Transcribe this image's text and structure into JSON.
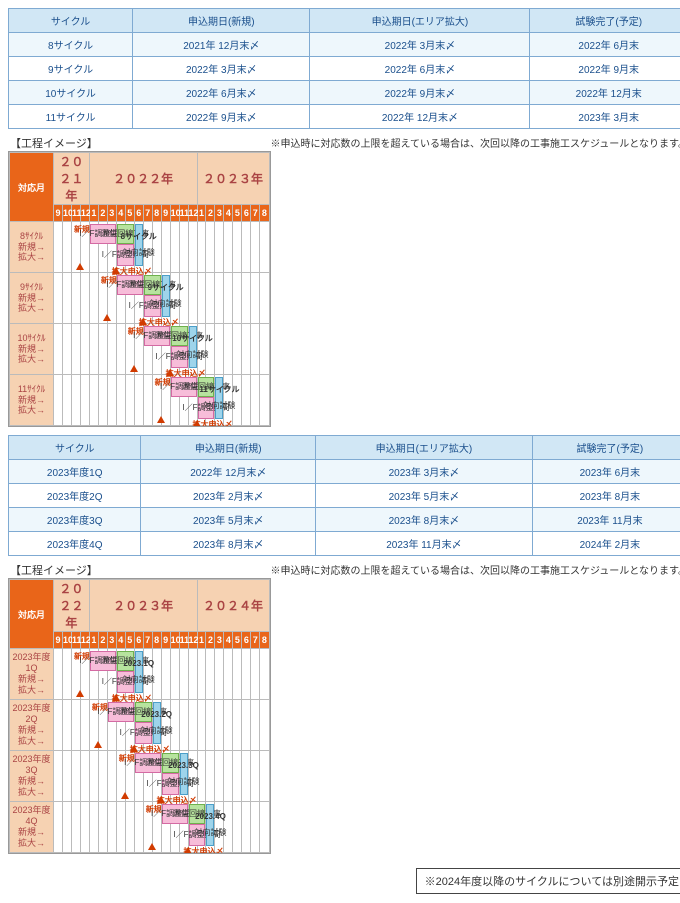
{
  "tables": {
    "headers": [
      "サイクル",
      "申込期日(新規)",
      "申込期日(エリア拡大)",
      "試験完了(予定)"
    ],
    "rows1": [
      [
        "8サイクル",
        "2021年 12月末〆",
        "2022年 3月末〆",
        "2022年 6月末"
      ],
      [
        "9サイクル",
        "2022年 3月末〆",
        "2022年 6月末〆",
        "2022年 9月末"
      ],
      [
        "10サイクル",
        "2022年 6月末〆",
        "2022年 9月末〆",
        "2022年 12月末"
      ],
      [
        "11サイクル",
        "2022年 9月末〆",
        "2022年 12月末〆",
        "2023年 3月末"
      ]
    ],
    "rows2": [
      [
        "2023年度1Q",
        "2022年 12月末〆",
        "2023年 3月末〆",
        "2023年 6月末"
      ],
      [
        "2023年度2Q",
        "2023年 2月末〆",
        "2023年 5月末〆",
        "2023年 8月末"
      ],
      [
        "2023年度3Q",
        "2023年 5月末〆",
        "2023年 8月末〆",
        "2023年 11月末"
      ],
      [
        "2023年度4Q",
        "2023年 8月末〆",
        "2023年 11月末〆",
        "2024年 2月末"
      ]
    ]
  },
  "titles": {
    "section": "【工程イメージ】",
    "note": "※申込時に対応数の上限を超えている場合は、次回以降の工事施工スケジュールとなります。",
    "footer": "※2024年度以降のサイクルについては別途開示予定"
  },
  "gantt": {
    "rowlabel_corner": "対応月",
    "years1": [
      "２０２１年",
      "２０２２年",
      "２０２３年"
    ],
    "months1": [
      "9",
      "10",
      "11",
      "12",
      "1",
      "2",
      "3",
      "4",
      "5",
      "6",
      "7",
      "8",
      "9",
      "10",
      "11",
      "12",
      "1",
      "2",
      "3",
      "4",
      "5",
      "6",
      "7",
      "8"
    ],
    "years2": [
      "２０２２年",
      "２０２３年",
      "２０２４年"
    ],
    "months2": [
      "9",
      "10",
      "11",
      "12",
      "1",
      "2",
      "3",
      "4",
      "5",
      "6",
      "7",
      "8",
      "9",
      "10",
      "11",
      "12",
      "1",
      "2",
      "3",
      "4",
      "5",
      "6",
      "7",
      "8"
    ],
    "rowlabels1": [
      "8ｻｲｸﾙ",
      "新規→",
      "拡大→",
      "9ｻｲｸﾙ",
      "新規→",
      "拡大→",
      "10ｻｲｸﾙ",
      "新規→",
      "拡大→",
      "11ｻｲｸﾙ",
      "新規→",
      "拡大→"
    ],
    "rowlabels2": [
      "2023年度1Q",
      "新規→",
      "拡大→",
      "2023年度2Q",
      "新規→",
      "拡大→",
      "2023年度3Q",
      "新規→",
      "拡大→",
      "2023年度4Q",
      "新規→",
      "拡大→"
    ],
    "text": {
      "shinki": "新規申込〆",
      "kakudai": "拡大申込〆",
      "if_period": "I／F調整期間",
      "line_work": "通信回線工事",
      "test_prefix_cycle": [
        "8サイクル",
        "9サイクル",
        "10サイクル",
        "11サイクル"
      ],
      "test_prefix_q": [
        "2023.1Q",
        "2023.2Q",
        "2023.3Q",
        "2023.4Q"
      ],
      "test": "対向試験"
    }
  },
  "chart_data": {
    "type": "gantt",
    "title": "工程イメージ",
    "sets": [
      {
        "timeline": {
          "start": "2021-09",
          "end": "2023-08"
        },
        "rows": [
          {
            "cycle": "8サイクル",
            "新規申込〆": "2021-12",
            "拡大申込〆": "2022-03",
            "I/F調整期間": {
              "新規": [
                "2022-01",
                "2022-03"
              ],
              "拡大": [
                "2022-04",
                "2022-05"
              ]
            },
            "通信回線工事": [
              "2022-04",
              "2022-05"
            ],
            "対向試験": [
              "2022-06",
              "2022-06"
            ]
          },
          {
            "cycle": "9サイクル",
            "新規申込〆": "2022-03",
            "拡大申込〆": "2022-06",
            "I/F調整期間": {
              "新規": [
                "2022-04",
                "2022-06"
              ],
              "拡大": [
                "2022-07",
                "2022-08"
              ]
            },
            "通信回線工事": [
              "2022-07",
              "2022-08"
            ],
            "対向試験": [
              "2022-09",
              "2022-09"
            ]
          },
          {
            "cycle": "10サイクル",
            "新規申込〆": "2022-06",
            "拡大申込〆": "2022-09",
            "I/F調整期間": {
              "新規": [
                "2022-07",
                "2022-09"
              ],
              "拡大": [
                "2022-10",
                "2022-11"
              ]
            },
            "通信回線工事": [
              "2022-10",
              "2022-11"
            ],
            "対向試験": [
              "2022-12",
              "2022-12"
            ]
          },
          {
            "cycle": "11サイクル",
            "新規申込〆": "2022-09",
            "拡大申込〆": "2022-12",
            "I/F調整期間": {
              "新規": [
                "2022-10",
                "2022-12"
              ],
              "拡大": [
                "2023-01",
                "2023-02"
              ]
            },
            "通信回線工事": [
              "2023-01",
              "2023-02"
            ],
            "対向試験": [
              "2023-03",
              "2023-03"
            ]
          }
        ]
      },
      {
        "timeline": {
          "start": "2022-09",
          "end": "2024-08"
        },
        "rows": [
          {
            "cycle": "2023年度1Q",
            "新規申込〆": "2022-12",
            "拡大申込〆": "2023-03",
            "I/F調整期間": {
              "新規": [
                "2023-01",
                "2023-03"
              ],
              "拡大": [
                "2023-04",
                "2023-05"
              ]
            },
            "通信回線工事": [
              "2023-04",
              "2023-05"
            ],
            "対向試験": [
              "2023-06",
              "2023-06"
            ]
          },
          {
            "cycle": "2023年度2Q",
            "新規申込〆": "2023-02",
            "拡大申込〆": "2023-05",
            "I/F調整期間": {
              "新規": [
                "2023-03",
                "2023-05"
              ],
              "拡大": [
                "2023-06",
                "2023-07"
              ]
            },
            "通信回線工事": [
              "2023-06",
              "2023-07"
            ],
            "対向試験": [
              "2023-08",
              "2023-08"
            ]
          },
          {
            "cycle": "2023年度3Q",
            "新規申込〆": "2023-05",
            "拡大申込〆": "2023-08",
            "I/F調整期間": {
              "新規": [
                "2023-06",
                "2023-08"
              ],
              "拡大": [
                "2023-09",
                "2023-10"
              ]
            },
            "通信回線工事": [
              "2023-09",
              "2023-10"
            ],
            "対向試験": [
              "2023-11",
              "2023-11"
            ]
          },
          {
            "cycle": "2023年度4Q",
            "新規申込〆": "2023-08",
            "拡大申込〆": "2023-11",
            "I/F調整期間": {
              "新規": [
                "2023-09",
                "2023-11"
              ],
              "拡大": [
                "2023-12",
                "2024-01"
              ]
            },
            "通信回線工事": [
              "2023-12",
              "2024-01"
            ],
            "対向試験": [
              "2024-02",
              "2024-02"
            ]
          }
        ]
      }
    ]
  }
}
